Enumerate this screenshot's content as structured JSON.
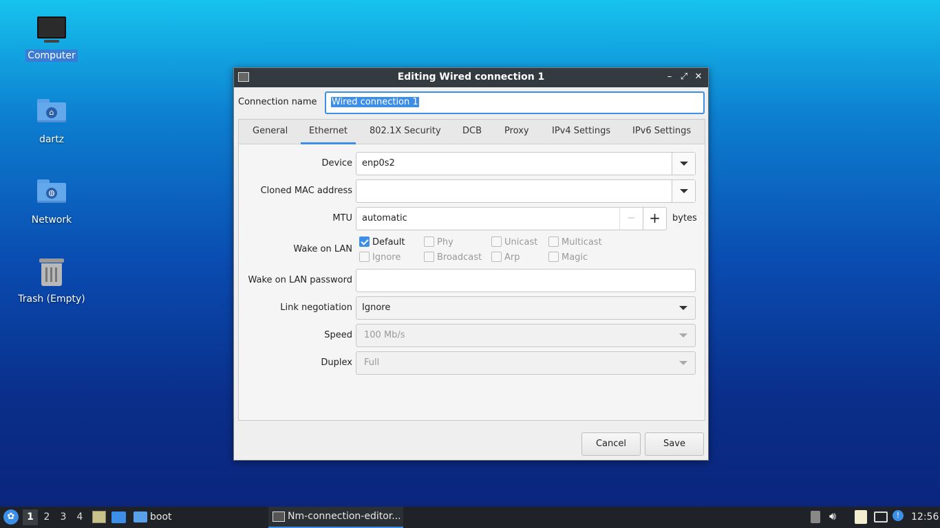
{
  "desktop": {
    "icons": [
      {
        "label": "Computer"
      },
      {
        "label": "dartz"
      },
      {
        "label": "Network"
      },
      {
        "label": "Trash (Empty)"
      }
    ]
  },
  "dialog": {
    "title": "Editing Wired connection 1",
    "connection_name_label": "Connection name",
    "connection_name_value": "Wired connection 1",
    "tabs": [
      {
        "label": "General"
      },
      {
        "label": "Ethernet"
      },
      {
        "label": "802.1X Security"
      },
      {
        "label": "DCB"
      },
      {
        "label": "Proxy"
      },
      {
        "label": "IPv4 Settings"
      },
      {
        "label": "IPv6 Settings"
      }
    ],
    "active_tab": "Ethernet",
    "fields": {
      "device_label": "Device",
      "device_value": "enp0s2",
      "cloned_mac_label": "Cloned MAC address",
      "cloned_mac_value": "",
      "mtu_label": "MTU",
      "mtu_value": "automatic",
      "mtu_unit": "bytes",
      "wol_label": "Wake on LAN",
      "wol_options": [
        {
          "label": "Default",
          "checked": true
        },
        {
          "label": "Phy",
          "checked": false
        },
        {
          "label": "Unicast",
          "checked": false
        },
        {
          "label": "Multicast",
          "checked": false
        },
        {
          "label": "Ignore",
          "checked": false
        },
        {
          "label": "Broadcast",
          "checked": false
        },
        {
          "label": "Arp",
          "checked": false
        },
        {
          "label": "Magic",
          "checked": false
        }
      ],
      "wol_password_label": "Wake on LAN password",
      "wol_password_value": "",
      "link_negotiation_label": "Link negotiation",
      "link_negotiation_value": "Ignore",
      "speed_label": "Speed",
      "speed_value": "100 Mb/s",
      "duplex_label": "Duplex",
      "duplex_value": "Full"
    },
    "buttons": {
      "cancel": "Cancel",
      "save": "Save"
    }
  },
  "taskbar": {
    "workspaces": [
      "1",
      "2",
      "3",
      "4"
    ],
    "active_workspace": "1",
    "launcher_folder_label": "boot",
    "active_task_label": "Nm-connection-editor...",
    "clock": "12:56"
  },
  "colors": {
    "accent": "#3d8ee6",
    "titlebar": "#333a40",
    "taskbar": "#1f2327"
  }
}
